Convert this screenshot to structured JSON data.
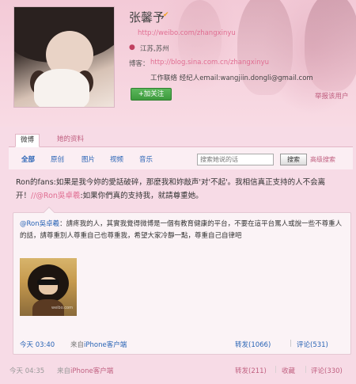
{
  "profile": {
    "name": "张馨予",
    "verified_icon": "verified-icon",
    "url": "http://weibo.com/zhangxinyu",
    "location": "江苏,苏州",
    "blog_label": "博客：",
    "blog_url": "http://blog.sina.com.cn/zhangxinyu",
    "contact": "工作联络  经纪人email:wangjiin.dongli@gmail.com",
    "follow_label": "+加关注",
    "report_label": "举报该用户"
  },
  "tabs": [
    {
      "label": "微博"
    },
    {
      "label": "她的资料"
    }
  ],
  "filters": [
    {
      "label": "全部"
    },
    {
      "label": "原创"
    },
    {
      "label": "图片"
    },
    {
      "label": "视频"
    },
    {
      "label": "音乐"
    }
  ],
  "search": {
    "placeholder": "搜索她说的话",
    "button_label": "搜索",
    "advanced_label": "高级搜索"
  },
  "post": {
    "text_part1": "Ron的fans:如果是我今妳的愛話破碎，那麼我和妳敲声'对'不起'。我相信真正支持的人不会离开！",
    "mention": "//@Ron吳卓羲",
    "text_part2": ":如果你們真的支持我，就請尊重她。"
  },
  "quote": {
    "author": "@Ron吳卓羲",
    "text": "：請疼我的人，其實我覺得微博是一個有教育健康的平台，不要在這平台罵人或說一些不尊重人的話，請尊重別人尊重自己也尊重我，希望大家冷靜一點，尊重自己自律吧",
    "image_watermark": "weibo.com",
    "time": "今天 03:40",
    "from_prefix": "来自",
    "from_source": "iPhone客户端",
    "forward_label": "转发(1066)",
    "separator": "|",
    "comment_label": "评论(531)"
  },
  "footer": {
    "time": "今天 04:35",
    "from_prefix": "来自",
    "from_source": "iPhone客户端",
    "forward_label": "转发(211)",
    "separator": "|",
    "favorite_label": "收藏",
    "comment_label": "评论(330)"
  },
  "colors": {
    "accent_pink": "#e06e92",
    "link_blue": "#2863b5",
    "follow_green": "#3d9a3d"
  }
}
